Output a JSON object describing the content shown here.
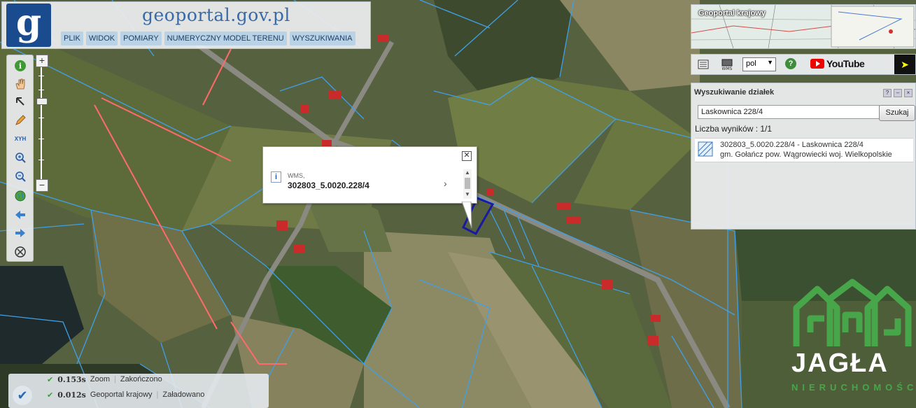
{
  "header": {
    "logo_letter": "g",
    "site_title": "geoportal.gov.pl",
    "menu": [
      "PLIK",
      "WIDOK",
      "POMIARY",
      "NUMERYCZNY MODEL TERENU",
      "WYSZUKIWANIA"
    ]
  },
  "toolbar": {
    "tools": [
      "info-icon",
      "hand-pan-icon",
      "pointer-arrow-icon",
      "pencil-icon",
      "xyh-icon",
      "zoom-in-icon",
      "zoom-out-icon",
      "globe-icon",
      "back-arrow-icon",
      "forward-arrow-icon",
      "clear-icon"
    ],
    "xyh_label": "XYH"
  },
  "zoom": {
    "plus": "+",
    "minus": "−"
  },
  "popup": {
    "source": "WMS,",
    "value": "302803_5.0020.228/4"
  },
  "minimap": {
    "title": "Geoportal krajowy"
  },
  "right_toolbar": {
    "language": "pol",
    "help": "?",
    "youtube": "YouTube"
  },
  "search": {
    "title": "Wyszukiwanie działek",
    "input_value": "Laskownica 228/4",
    "button": "Szukaj",
    "result_count": "Liczba wyników : 1/1",
    "result_line1": "302803_5.0020.228/4 - Laskownica 228/4",
    "result_line2": "gm. Gołańcz pow. Wągrowiecki woj. Wielkopolskie"
  },
  "status": {
    "rows": [
      {
        "time": "0.153s",
        "label": "Zoom",
        "state": "Zakończono"
      },
      {
        "time": "0.012s",
        "label": "Geoportal krajowy",
        "state": "Załadowano"
      }
    ]
  },
  "watermark": {
    "name": "JAGŁA",
    "sub": "NIERUCHOMOŚCI"
  },
  "colors": {
    "brand": "#1b4b8f",
    "parcel": "#3fa0e8",
    "highlight": "#1a1aa0",
    "watermark_green": "#48a64a"
  }
}
